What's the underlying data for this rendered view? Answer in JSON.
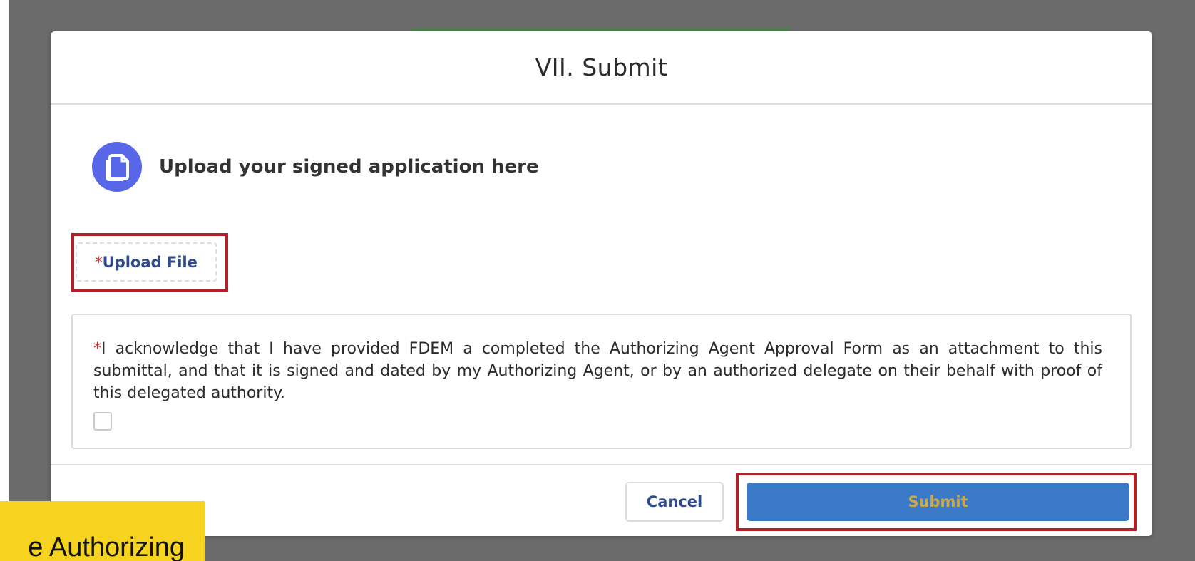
{
  "modal": {
    "title": "VII. Submit",
    "section": {
      "icon": "document-copy-icon",
      "icon_color": "#5867e8",
      "title": "Upload your signed application here"
    },
    "upload": {
      "required_marker": "*",
      "label": "Upload File"
    },
    "acknowledgement": {
      "required_marker": "*",
      "text": "I acknowledge that I have provided FDEM a completed the Authorizing Agent Approval Form as an attachment to this submittal, and that it is signed and dated by my Authorizing Agent, or by an authorized delegate on their behalf with proof of this delegated authority.",
      "checked": false
    },
    "footer": {
      "cancel_label": "Cancel",
      "submit_label": "Submit"
    }
  },
  "caption": {
    "text": "e Authorizing"
  },
  "colors": {
    "backdrop": "#6b6b6b",
    "highlight_border": "#b3202a",
    "submit_bg": "#3a78c8",
    "submit_text": "#c9a94a",
    "required": "#c23934",
    "caption_bg": "#f5d31f"
  }
}
